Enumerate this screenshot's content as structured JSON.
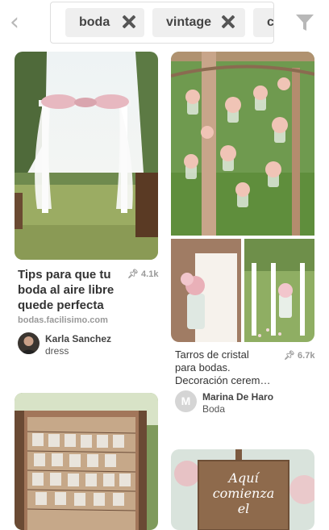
{
  "topbar": {
    "back_icon": "chevron-left-icon",
    "chips": [
      {
        "label": "boda"
      },
      {
        "label": "vintage"
      },
      {
        "label": "c"
      }
    ],
    "filter_icon": "funnel-icon"
  },
  "pins": [
    {
      "title_lines": [
        "Tips para que tu",
        "boda al aire libre",
        "quede perfecta"
      ],
      "saves": "4.1k",
      "source": "bodas.facilisimo.com",
      "user": "Karla Sanchez",
      "board": "dress"
    },
    {
      "desc_lines": [
        "Tarros de cristal",
        "para bodas.",
        "Decoración cerem…"
      ],
      "saves": "6.7k",
      "user": "Marina De Haro",
      "avatar_letter": "M",
      "board": "Boda"
    },
    {
      "image": "photo-wall-with-clothespins"
    },
    {
      "sign_lines": [
        "Aquí",
        "comienza",
        "el"
      ]
    }
  ],
  "colors": {
    "icon_gray": "#b8b8b8",
    "chip_bg": "#efefef",
    "meta_gray": "#999999"
  }
}
